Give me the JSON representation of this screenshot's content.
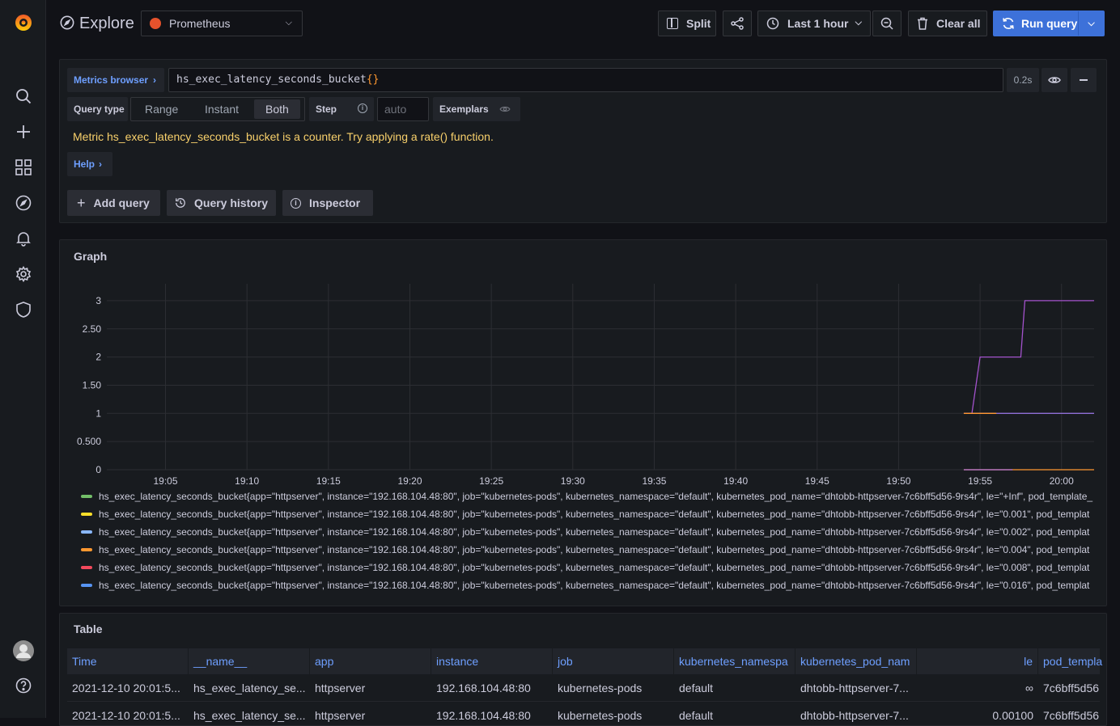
{
  "nav": {
    "items": [
      "search",
      "create",
      "dashboards",
      "explore",
      "alerting",
      "configuration",
      "server-admin"
    ]
  },
  "header": {
    "title": "Explore",
    "datasource": "Prometheus",
    "split_label": "Split",
    "time_range_label": "Last 1 hour",
    "clear_all_label": "Clear all",
    "run_query_label": "Run query"
  },
  "query": {
    "metrics_browser_label": "Metrics browser",
    "expression": "hs_exec_latency_seconds_bucket",
    "expression_suffix": "{}",
    "duration": "0.2s",
    "query_type_label": "Query type",
    "query_types": [
      "Range",
      "Instant",
      "Both"
    ],
    "selected_query_type": "Both",
    "step_label": "Step",
    "step_placeholder": "auto",
    "exemplars_label": "Exemplars",
    "warning": "Metric hs_exec_latency_seconds_bucket is a counter. Try applying a rate() function.",
    "help_label": "Help",
    "add_query_label": "Add query",
    "query_history_label": "Query history",
    "inspector_label": "Inspector"
  },
  "graph": {
    "title": "Graph",
    "legend": [
      {
        "color": "#73bf69",
        "text": "hs_exec_latency_seconds_bucket{app=\"httpserver\", instance=\"192.168.104.48:80\", job=\"kubernetes-pods\", kubernetes_namespace=\"default\", kubernetes_pod_name=\"dhtobb-httpserver-7c6bff5d56-9rs4r\", le=\"+Inf\", pod_template_"
      },
      {
        "color": "#fade2a",
        "text": "hs_exec_latency_seconds_bucket{app=\"httpserver\", instance=\"192.168.104.48:80\", job=\"kubernetes-pods\", kubernetes_namespace=\"default\", kubernetes_pod_name=\"dhtobb-httpserver-7c6bff5d56-9rs4r\", le=\"0.001\", pod_templat"
      },
      {
        "color": "#8ab8ff",
        "text": "hs_exec_latency_seconds_bucket{app=\"httpserver\", instance=\"192.168.104.48:80\", job=\"kubernetes-pods\", kubernetes_namespace=\"default\", kubernetes_pod_name=\"dhtobb-httpserver-7c6bff5d56-9rs4r\", le=\"0.002\", pod_templat"
      },
      {
        "color": "#ff9830",
        "text": "hs_exec_latency_seconds_bucket{app=\"httpserver\", instance=\"192.168.104.48:80\", job=\"kubernetes-pods\", kubernetes_namespace=\"default\", kubernetes_pod_name=\"dhtobb-httpserver-7c6bff5d56-9rs4r\", le=\"0.004\", pod_templat"
      },
      {
        "color": "#f2495c",
        "text": "hs_exec_latency_seconds_bucket{app=\"httpserver\", instance=\"192.168.104.48:80\", job=\"kubernetes-pods\", kubernetes_namespace=\"default\", kubernetes_pod_name=\"dhtobb-httpserver-7c6bff5d56-9rs4r\", le=\"0.008\", pod_templat"
      },
      {
        "color": "#5794f2",
        "text": "hs_exec_latency_seconds_bucket{app=\"httpserver\", instance=\"192.168.104.48:80\", job=\"kubernetes-pods\", kubernetes_namespace=\"default\", kubernetes_pod_name=\"dhtobb-httpserver-7c6bff5d56-9rs4r\", le=\"0.016\", pod_templat"
      }
    ]
  },
  "chart_data": {
    "type": "line",
    "x_ticks": [
      "19:05",
      "19:10",
      "19:15",
      "19:20",
      "19:25",
      "19:30",
      "19:35",
      "19:40",
      "19:45",
      "19:50",
      "19:55",
      "20:00"
    ],
    "y_ticks": [
      "0",
      "0.500",
      "1",
      "1.50",
      "2",
      "2.50",
      "3"
    ],
    "ylim": [
      0,
      3.3
    ],
    "xlim_minutes": [
      "19:01",
      "20:02"
    ],
    "grid": true,
    "series": [
      {
        "color": "#a352cc",
        "points": [
          [
            "19:54",
            1
          ],
          [
            "19:54:30",
            1
          ],
          [
            "19:55",
            2
          ],
          [
            "19:57:30",
            2
          ],
          [
            "19:57:45",
            3
          ],
          [
            "20:02",
            3
          ]
        ]
      },
      {
        "color": "#8f6fd6",
        "points": [
          [
            "19:54",
            1
          ],
          [
            "20:02",
            1
          ]
        ]
      },
      {
        "color": "#ff9830",
        "points": [
          [
            "19:54",
            1
          ],
          [
            "19:56",
            1
          ]
        ]
      },
      {
        "color": "#ff9830",
        "points": [
          [
            "19:54",
            0
          ],
          [
            "20:02",
            0
          ]
        ]
      },
      {
        "color": "#b877d9",
        "points": [
          [
            "19:54",
            0
          ],
          [
            "19:57",
            0
          ]
        ]
      }
    ]
  },
  "table": {
    "title": "Table",
    "columns": [
      "Time",
      "__name__",
      "app",
      "instance",
      "job",
      "kubernetes_namespa",
      "kubernetes_pod_nam",
      "le",
      "pod_templa"
    ],
    "rows": [
      [
        "2021-12-10 20:01:5...",
        "hs_exec_latency_se...",
        "httpserver",
        "192.168.104.48:80",
        "kubernetes-pods",
        "default",
        "dhtobb-httpserver-7...",
        "∞",
        "7c6bff5d56"
      ],
      [
        "2021-12-10 20:01:5...",
        "hs_exec_latency_se...",
        "httpserver",
        "192.168.104.48:80",
        "kubernetes-pods",
        "default",
        "dhtobb-httpserver-7...",
        "0.00100",
        "7c6bff5d56"
      ]
    ]
  }
}
